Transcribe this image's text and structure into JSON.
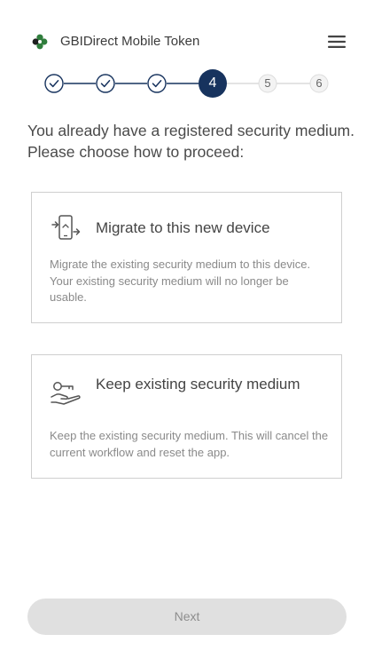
{
  "header": {
    "logo": "clover-logo-icon",
    "title": "GBIDirect  Mobile Token",
    "menu_icon": "hamburger-menu-icon"
  },
  "stepper": {
    "current_step": 4,
    "total_steps": 6,
    "completed_steps": [
      1,
      2,
      3
    ],
    "step_labels": [
      "1",
      "2",
      "3",
      "4",
      "5",
      "6"
    ],
    "active_color": "#17335e"
  },
  "intro": {
    "text": "You already have a registered security medium. Please choose how to proceed:"
  },
  "options": [
    {
      "icon": "device-migrate-icon",
      "title": "Migrate to this new device",
      "description": "Migrate the existing security medium to this device. Your existing security medium will no longer be usable."
    },
    {
      "icon": "hand-with-key-icon",
      "title": "Keep existing security medium",
      "description": "Keep the existing security medium. This will cancel the current workflow and reset the app."
    }
  ],
  "footer": {
    "next_label": "Next",
    "next_enabled": false
  },
  "colors": {
    "brand_navy": "#17335e",
    "logo_green": "#2f7d3c",
    "text_primary": "#444444",
    "text_secondary": "#8a8a8a",
    "border": "#cfcfcf",
    "button_disabled_bg": "#e0e0e0"
  }
}
